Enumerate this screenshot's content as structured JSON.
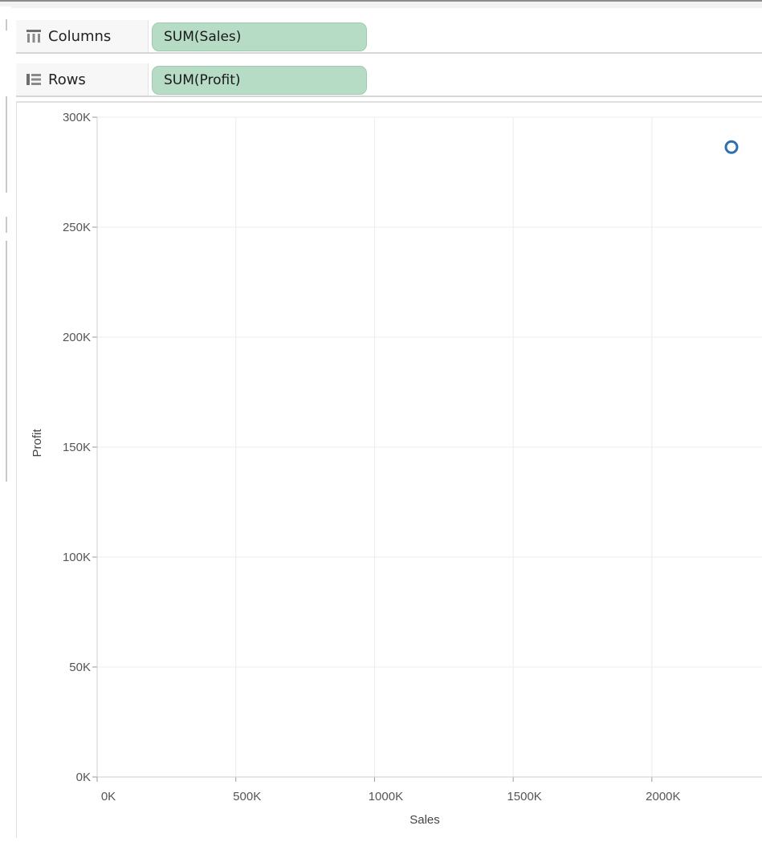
{
  "shelves": {
    "columns": {
      "label": "Columns",
      "pill": "SUM(Sales)"
    },
    "rows": {
      "label": "Rows",
      "pill": "SUM(Profit)"
    }
  },
  "icons": {
    "columns": "columns-icon",
    "rows": "rows-icon",
    "mark": "circle-mark"
  },
  "colors": {
    "pill": "#b7dcc6",
    "mark": "#2f6fb0",
    "grid": "#ececec"
  },
  "chart_data": {
    "type": "scatter",
    "xlabel": "Sales",
    "ylabel": "Profit",
    "xlim": [
      0,
      2400000
    ],
    "ylim": [
      0,
      300000
    ],
    "x_ticks": [
      {
        "value": 0,
        "label": "0K"
      },
      {
        "value": 500000,
        "label": "500K"
      },
      {
        "value": 1000000,
        "label": "1000K"
      },
      {
        "value": 1500000,
        "label": "1500K"
      },
      {
        "value": 2000000,
        "label": "2000K"
      }
    ],
    "y_ticks": [
      {
        "value": 0,
        "label": "0K"
      },
      {
        "value": 50000,
        "label": "50K"
      },
      {
        "value": 100000,
        "label": "100K"
      },
      {
        "value": 150000,
        "label": "150K"
      },
      {
        "value": 200000,
        "label": "200K"
      },
      {
        "value": 250000,
        "label": "250K"
      },
      {
        "value": 300000,
        "label": "300K"
      }
    ],
    "points": [
      {
        "x": 2287000,
        "y": 286400
      }
    ],
    "grid": true,
    "marker": "open-circle"
  }
}
